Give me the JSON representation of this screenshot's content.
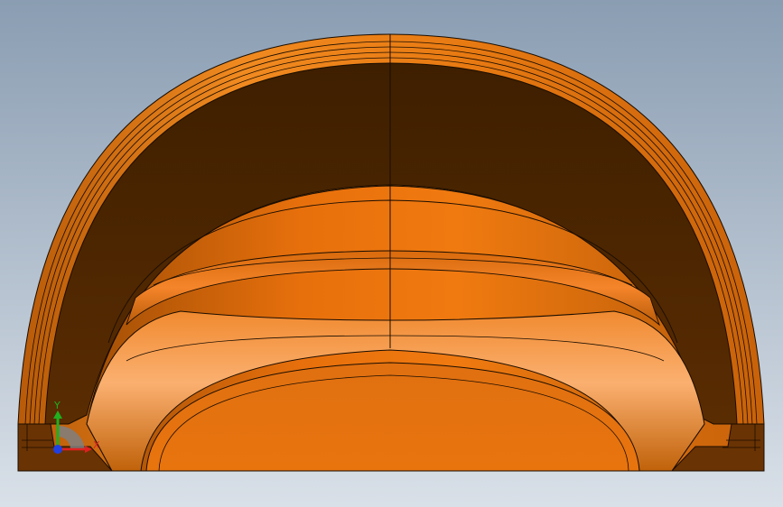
{
  "viewport": {
    "background_top_color": "#8a9db2",
    "background_bottom_color": "#d9e0e8"
  },
  "model": {
    "part_name": "",
    "face_colors": {
      "bright": "#f07a10",
      "mid": "#d8690c",
      "shadow": "#7a3a05",
      "interior_dark": "#4a2500",
      "edge_line": "#1a0d00"
    }
  },
  "triad": {
    "x_label": "X",
    "y_label": "Y",
    "x_color": "#e02020",
    "y_color": "#20b020",
    "z_color": "#2040e0"
  }
}
